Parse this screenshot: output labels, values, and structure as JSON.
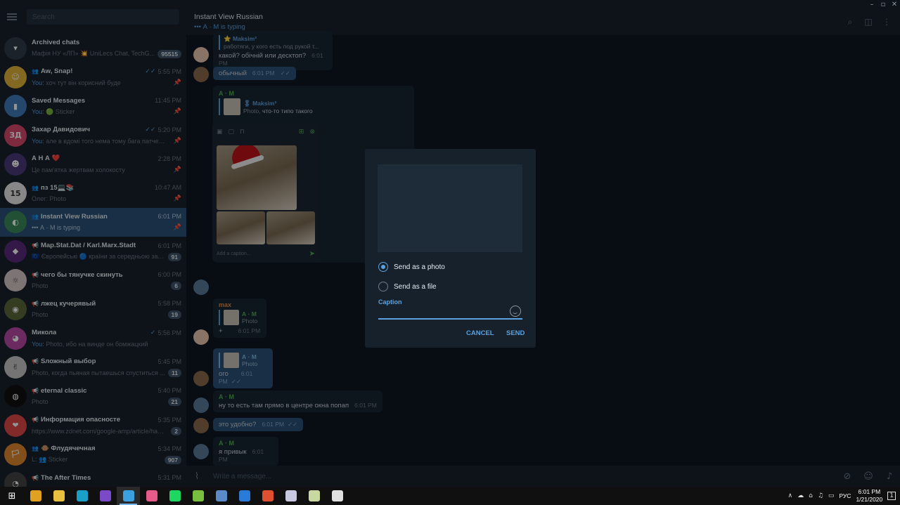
{
  "window": {
    "controls": [
      "–",
      "▫",
      "✕"
    ]
  },
  "sidebar": {
    "search_placeholder": "Search",
    "chats": [
      {
        "name": "Archived chats",
        "preview": "Мафія НУ «ЛП» 💥 UniLecs Chat, TechG...",
        "badge": "95515",
        "avatar_color": "#2f3b48",
        "avatar_text": "▾"
      },
      {
        "name": "Aw, Snap!",
        "group": true,
        "time": "5:55 PM",
        "you": "You:",
        "preview": " хоч тут він корисний буде",
        "check": "✓✓",
        "pinned": true,
        "avatar_color": "#e0b43a",
        "avatar_text": "☺"
      },
      {
        "name": "Saved Messages",
        "time": "11:45 PM",
        "you": "You:",
        "preview": " 🟢 Sticker",
        "pinned": true,
        "avatar_color": "#3e7bb8",
        "avatar_text": "▮"
      },
      {
        "name": "Захар Давидович",
        "time": "5:20 PM",
        "you": "You:",
        "preview": " але в вдомі того нема тому бага патчера)",
        "check": "✓✓",
        "pinned": true,
        "avatar_color": "#d8486b",
        "avatar_text": "ЗД"
      },
      {
        "name": "А Н А ❤️",
        "time": "2:28 PM",
        "preview": "Це пам'ятка жертвам холокосту",
        "pinned": true,
        "avatar_color": "#4a3a7a",
        "avatar_text": "☻"
      },
      {
        "name": "пз 15💻📚",
        "group": true,
        "time": "10:47 AM",
        "preview": "Олег: Photo",
        "pinned": true,
        "avatar_color": "#e8e8e8",
        "avatar_text": "15",
        "avatar_fg": "#333"
      },
      {
        "name": "Instant View Russian",
        "group": true,
        "time": "6:01 PM",
        "preview": "••• А · М is typing",
        "pinned": true,
        "active": true,
        "avatar_color": "#3a8a5a",
        "avatar_text": "◐"
      },
      {
        "name": "Map.Stat.Dat / Karl.Marx.Stadt",
        "channel": true,
        "time": "6:01 PM",
        "preview": "🇪🇺 Європейські 🔵 країни за середньою заро...",
        "badge": "91",
        "avatar_color": "#5a2a7a",
        "avatar_text": "◆"
      },
      {
        "name": "чего бы тянучке скинуть",
        "channel": true,
        "time": "6:00 PM",
        "preview": "Photo",
        "badge": "6",
        "avatar_color": "#d8c8c8",
        "avatar_text": "☼",
        "avatar_fg": "#555"
      },
      {
        "name": "лжец кучерявый",
        "channel": true,
        "time": "5:58 PM",
        "preview": "Photo",
        "badge": "19",
        "avatar_color": "#5a6a3a",
        "avatar_text": "◉"
      },
      {
        "name": "Микола",
        "time": "5:56 PM",
        "you": "You:",
        "preview": " Photo, ибо на винде он бомжацкий",
        "check": "✓",
        "avatar_color": "#b84aa8",
        "avatar_text": "◕"
      },
      {
        "name": "Sложный выбор",
        "channel": true,
        "time": "5:45 PM",
        "preview": "Photo, когда пьяная пытаешься спуститься ...",
        "badge": "11",
        "avatar_color": "#c8c8c8",
        "avatar_text": "✌",
        "avatar_fg": "#333"
      },
      {
        "name": "eternal classic",
        "channel": true,
        "time": "5:40 PM",
        "preview": "Photo",
        "badge": "21",
        "avatar_color": "#111111",
        "avatar_text": "◍"
      },
      {
        "name": "Информация опасносте",
        "channel": true,
        "time": "5:35 PM",
        "preview": "https://www.zdnet.com/google-amp/article/hac...",
        "badge": "2",
        "avatar_color": "#e04848",
        "avatar_text": "❤"
      },
      {
        "name": "🐵 Флудячечная",
        "group": true,
        "time": "5:34 PM",
        "preview": "L: 👥 Sticker",
        "badge": "907",
        "avatar_color": "#e08830",
        "avatar_text": "🏳"
      },
      {
        "name": "The After Times",
        "channel": true,
        "time": "5:31 PM",
        "preview": "",
        "avatar_color": "#444444",
        "avatar_text": "◔"
      }
    ]
  },
  "header": {
    "title": "Instant View Russian",
    "status": "••• А · М is typing"
  },
  "messages": {
    "m1_reply_name": "⭐ Maksim³",
    "m1_reply_text": "работяги, у кого есть под рукой т...",
    "m1_text": "какой? обічній или десктоп?",
    "m1_time": "6:01 PM",
    "m2_text": "обычный",
    "m2_time": "6:01 PM",
    "m3_sender": "А · М",
    "m3_reply_name": "🎖 Maksim³",
    "m3_reply_photo": "Photo,",
    "m3_reply_text": " что-то типо такого",
    "m4_sender": "max",
    "m4_reply_name": "А · М",
    "m4_reply_text": "Photo",
    "m4_text": "+",
    "m4_time": "6:01 PM",
    "m5_reply_name": "А · М",
    "m5_reply_text": "Photo",
    "m5_text": "ого",
    "m5_time": "6:01 PM",
    "m6_sender": "А · М",
    "m6_text": "ну то есть там прямо в центре окна попап",
    "m6_time": "6:01 PM",
    "m7_text": "это удобно?",
    "m7_time": "6:01 PM",
    "m8_sender": "А · М",
    "m8_text": "я привык",
    "m8_time": "6:01 PM",
    "embed_caption": "Add a caption..."
  },
  "dialog": {
    "option_photo": "Send as a photo",
    "option_file": "Send as a file",
    "caption_label": "Caption",
    "cancel": "CANCEL",
    "send": "SEND"
  },
  "composer": {
    "placeholder": "Write a message..."
  },
  "taskbar": {
    "apps": [
      {
        "name": "chrome",
        "color": "#e0a020"
      },
      {
        "name": "files",
        "color": "#e8c040"
      },
      {
        "name": "webstorm",
        "color": "#1aa0c8"
      },
      {
        "name": "visual-studio",
        "color": "#7a4ac8"
      },
      {
        "name": "telegram",
        "color": "#3aa0e0",
        "active": true
      },
      {
        "name": "app-pink",
        "color": "#e85a8a"
      },
      {
        "name": "spotify",
        "color": "#1ed760"
      },
      {
        "name": "android",
        "color": "#7ac040"
      },
      {
        "name": "app-window",
        "color": "#5a8ac8"
      },
      {
        "name": "edge",
        "color": "#2a7ad8"
      },
      {
        "name": "git",
        "color": "#e05030"
      },
      {
        "name": "paint",
        "color": "#c8c8e0"
      },
      {
        "name": "app-tools",
        "color": "#c8d8a0"
      },
      {
        "name": "photos",
        "color": "#e0e0e0"
      }
    ],
    "language": "РУС",
    "time": "6:01 PM",
    "date": "1/21/2020",
    "notifications": "1"
  }
}
